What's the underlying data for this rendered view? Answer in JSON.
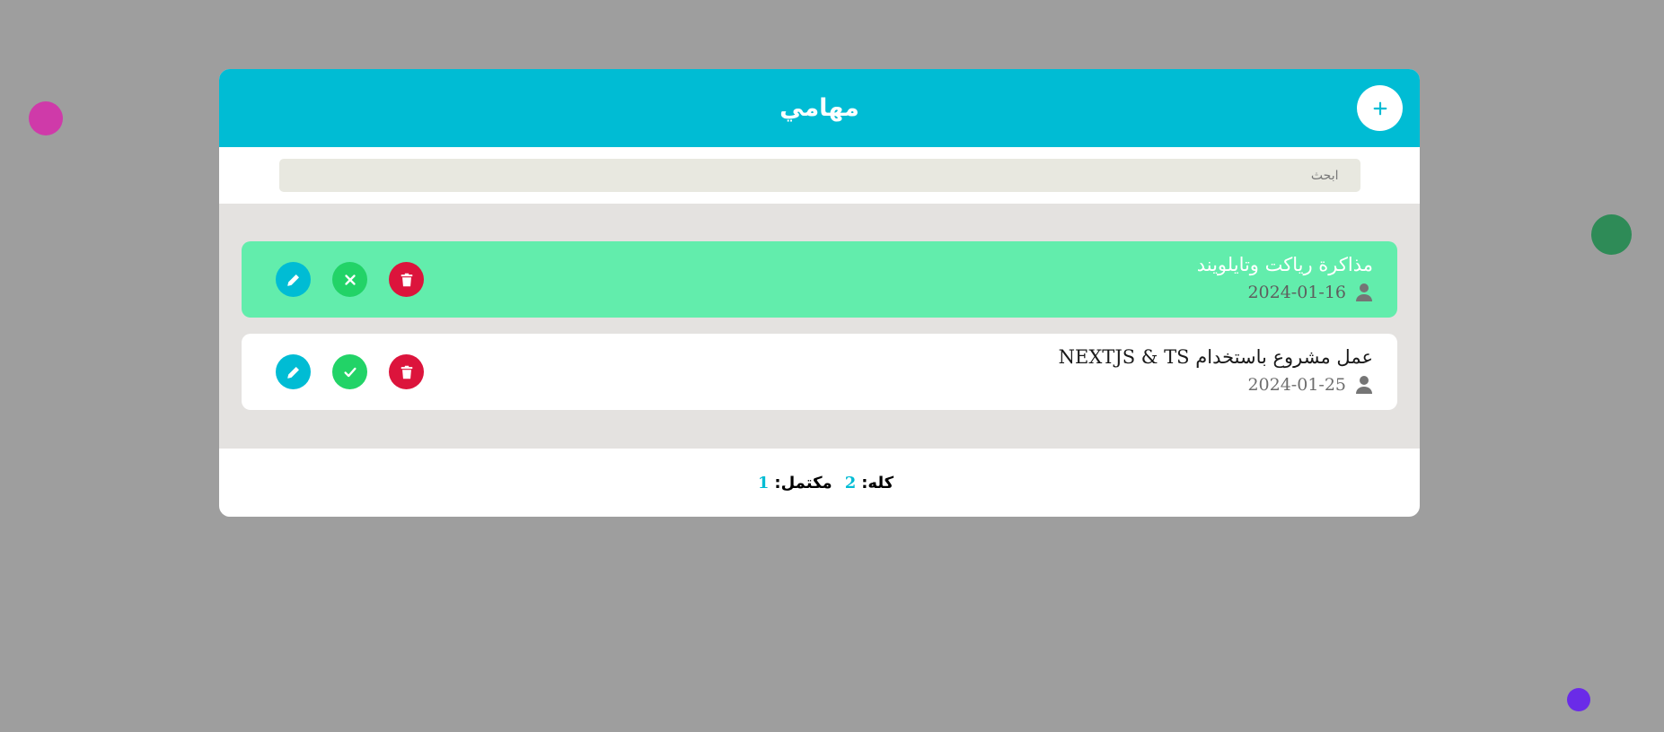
{
  "app": {
    "title": "مهامي",
    "add_label": "+",
    "search_placeholder": "ابحث",
    "colors": {
      "accent": "#00bcd4",
      "done_task_bg": "#62edac",
      "edit": "#00bcd4",
      "toggle": "#22d367",
      "delete": "#dc143c",
      "backdrop": "#9e9e9e"
    }
  },
  "tasks": [
    {
      "title": "مذاكرة رياكت وتايلويند",
      "date": "2024-01-16",
      "completed": true,
      "toggle_icon": "x-icon"
    },
    {
      "title": "عمل مشروع باستخدام NEXTJS & TS",
      "date": "2024-01-25",
      "completed": false,
      "toggle_icon": "check-icon"
    }
  ],
  "footer": {
    "total_label": "كله:",
    "total_value": "2",
    "completed_label": "مكتمل:",
    "completed_value": "1"
  }
}
